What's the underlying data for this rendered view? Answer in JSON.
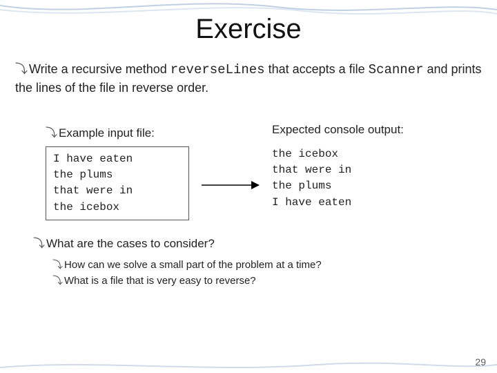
{
  "title": "Exercise",
  "main_bullet": {
    "pre": "Write a recursive method ",
    "code1": "reverseLines",
    "mid": " that accepts a file ",
    "code2": "Scanner",
    "post": " and prints the lines of the file in reverse order."
  },
  "example": {
    "label_left": "Example input file:",
    "label_right": "Expected console output:",
    "input_lines": "I have eaten\nthe plums\nthat were in\nthe icebox",
    "output_lines": "the icebox\nthat were in\nthe plums\nI have eaten"
  },
  "cases": {
    "head": "What are the cases to consider?",
    "subs": [
      "How can we solve a small part of the problem at a time?",
      "What is a file that is very easy to reverse?"
    ]
  },
  "page_number": "29",
  "glyph": "⤵"
}
